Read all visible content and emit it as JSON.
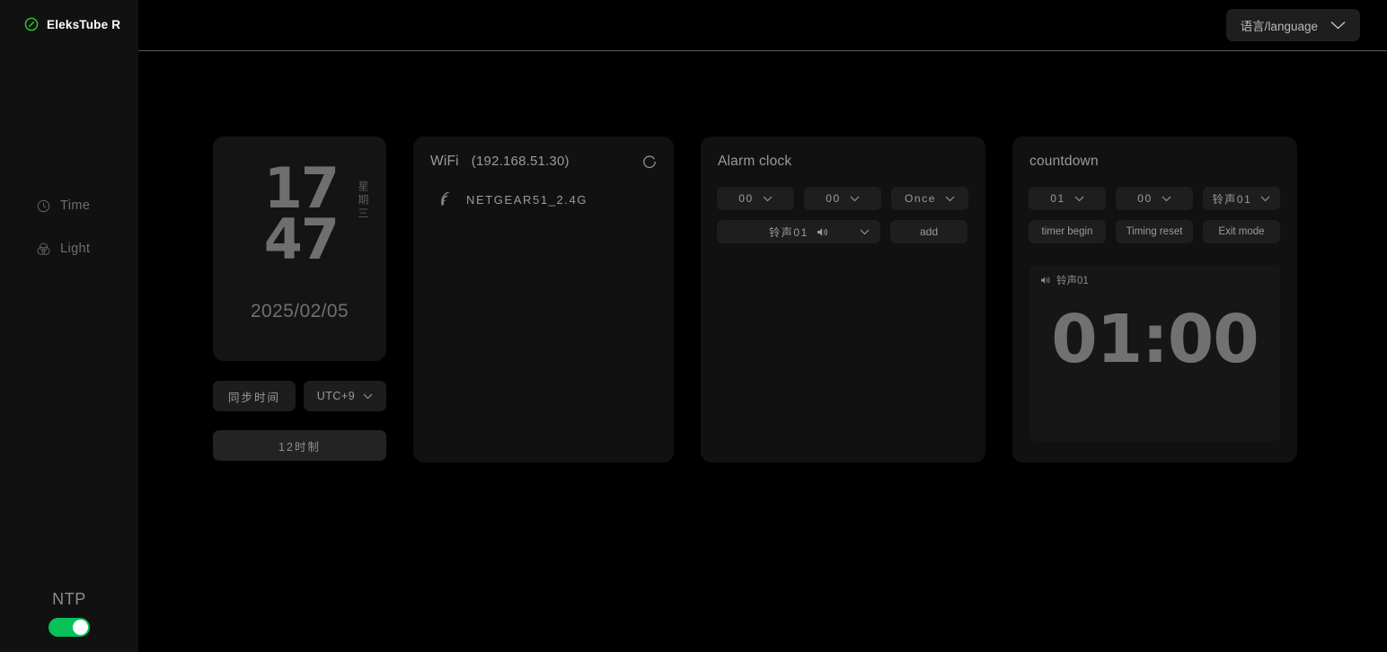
{
  "brand": {
    "name": "EleksTube R",
    "icon": "pill-link-icon"
  },
  "sidebar": {
    "items": [
      {
        "label": "Time",
        "icon": "clock-icon"
      },
      {
        "label": "Light",
        "icon": "color-circles-icon"
      }
    ],
    "ntp": {
      "label": "NTP",
      "enabled": true,
      "accent": "#07c25a"
    }
  },
  "topbar": {
    "language_label": "语言/language"
  },
  "clock": {
    "hours": "17",
    "minutes": "47",
    "weekday": "星期三",
    "date": "2025/02/05",
    "sync_label": "同步时间",
    "timezone": "UTC+9",
    "hour_format_label": "12时制"
  },
  "wifi": {
    "title": "WiFi",
    "ip": "(192.168.51.30)",
    "refresh_icon": "refresh-icon",
    "network": {
      "ssid": "NETGEAR51_2.4G",
      "icon": "wifi-signal-icon"
    }
  },
  "alarm": {
    "title": "Alarm clock",
    "hour": "00",
    "minute": "00",
    "repeat": "Once",
    "ringtone": "铃声01",
    "add_label": "add"
  },
  "countdown": {
    "title": "countdown",
    "minutes": "01",
    "seconds": "00",
    "ringtone": "铃声01",
    "start_label": "timer begin",
    "reset_label": "Timing reset",
    "exit_label": "Exit mode",
    "display": {
      "ringtone": "铃声01",
      "time": "01:00"
    }
  },
  "colors": {
    "page_bg": "#000000",
    "panel_bg": "#111111",
    "card_bg": "#141414",
    "control_bg": "#1e1e1e",
    "text_muted": "#9b9b9b",
    "accent_green": "#07c25a"
  }
}
